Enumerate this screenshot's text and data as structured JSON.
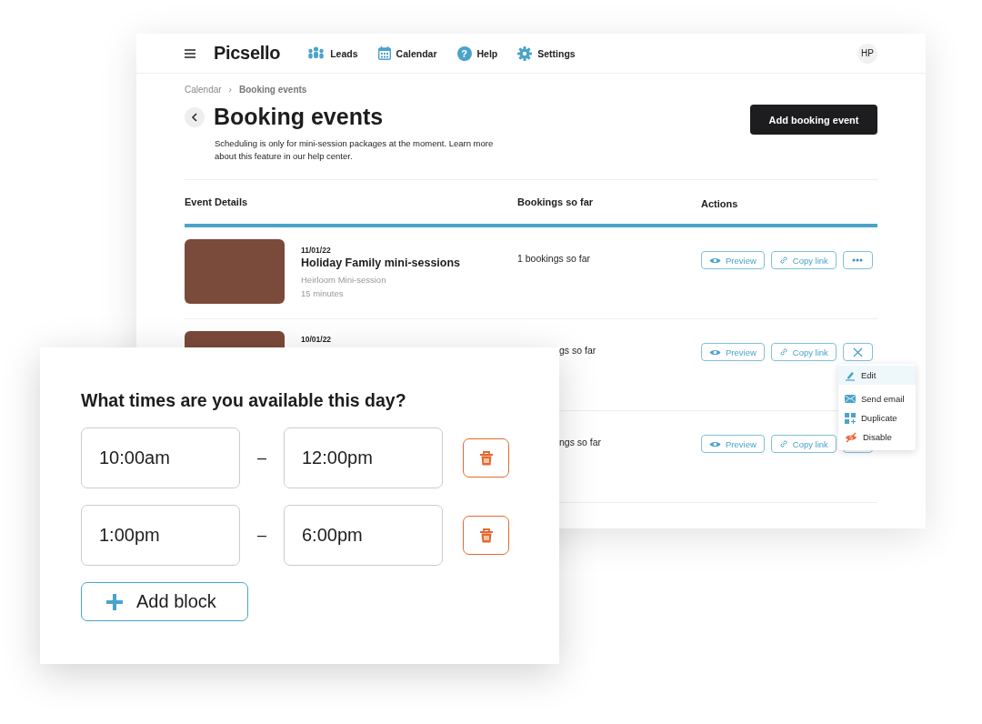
{
  "header": {
    "logo": "Picsello",
    "nav": [
      {
        "kind": "people",
        "label": "Leads"
      },
      {
        "kind": "calendar",
        "label": "Calendar"
      },
      {
        "kind": "help",
        "label": "Help",
        "icon_text": "?"
      },
      {
        "kind": "gear",
        "label": "Settings"
      }
    ],
    "avatar": "HP"
  },
  "breadcrumb": [
    "Calendar",
    "Booking events"
  ],
  "breadcrumb_separator": "›",
  "title": "Booking events",
  "description": "Scheduling is only for mini-session packages at the moment. Learn more about this feature in our help center.",
  "add_button": "Add booking event",
  "table": {
    "columns": [
      "Event Details",
      "Bookings so far",
      "Actions"
    ],
    "rows": [
      {
        "covered": false,
        "date": "11/01/22",
        "title": "Holiday Family mini-sessions",
        "package": "Heirloom Mini-session",
        "duration": "15 minutes",
        "bookings": "1 bookings so far",
        "preview": "Preview",
        "copy": "Copy link",
        "menu_open": false
      },
      {
        "covered": true,
        "date": "10/01/22",
        "bookings": "gs so far",
        "preview": "Preview",
        "copy": "Copy link",
        "menu_open": true
      },
      {
        "covered": true,
        "bookings": "ngs so far",
        "preview": "Preview",
        "copy": "Copy link",
        "menu_open": false
      }
    ]
  },
  "menu": [
    {
      "kind": "edit",
      "label": "Edit",
      "selected": true
    },
    {
      "kind": "email",
      "label": "Send email",
      "selected": false
    },
    {
      "kind": "duplicate",
      "label": "Duplicate",
      "selected": false
    },
    {
      "kind": "disable",
      "label": "Disable",
      "selected": false
    }
  ],
  "availability": {
    "heading": "What times are you available this day?",
    "blocks": [
      {
        "start": "10:00am",
        "separator": "–",
        "end": "12:00pm"
      },
      {
        "start": "1:00pm",
        "separator": "–",
        "end": "6:00pm"
      }
    ],
    "add_button": "Add block"
  }
}
